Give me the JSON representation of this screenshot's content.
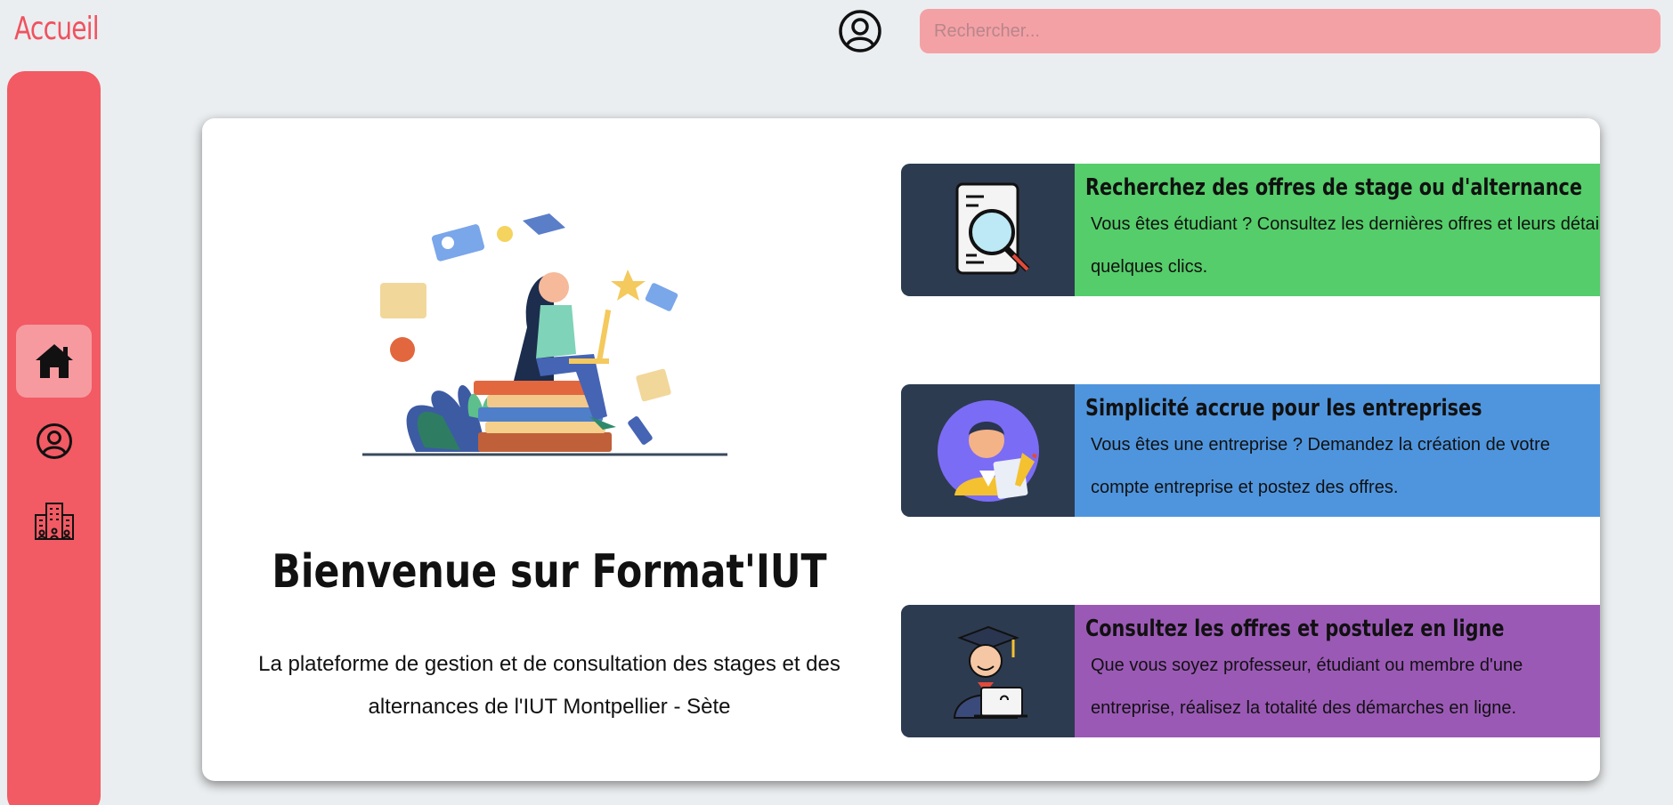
{
  "header": {
    "title": "Accueil",
    "search": {
      "placeholder": "Rechercher...",
      "value": ""
    },
    "profile_icon": "user-circle-icon"
  },
  "sidebar": {
    "items": [
      {
        "name": "home",
        "icon": "home-icon",
        "active": true
      },
      {
        "name": "profile",
        "icon": "user-circle-icon",
        "active": false
      },
      {
        "name": "companies",
        "icon": "building-icon",
        "active": false
      }
    ]
  },
  "main": {
    "welcome_title": "Bienvenue sur Format'IUT",
    "welcome_subtitle": "La plateforme de gestion et de consultation des stages et des alternances de l'IUT Montpellier - Sète",
    "features": [
      {
        "title": "Recherchez des offres de stage ou d'alternance",
        "description": "Vous êtes étudiant ? Consultez les dernières offres et leurs détails en quelques clics.",
        "color": "#55cd6a",
        "icon": "document-search-icon"
      },
      {
        "title": "Simplicité accrue pour les entreprises",
        "description": "Vous êtes une entreprise ? Demandez la création de votre compte entreprise et postez des offres.",
        "color": "#4f95de",
        "icon": "businessman-icon"
      },
      {
        "title": "Consultez les offres et postulez en ligne",
        "description": "Que vous soyez professeur, étudiant ou membre d'une entreprise, réalisez la totalité des démarches en ligne.",
        "color": "#9b59b6",
        "icon": "graduate-laptop-icon"
      }
    ]
  },
  "colors": {
    "accent": "#f25a64",
    "background": "#ebeef0",
    "feature_thumb": "#2d3b50"
  }
}
